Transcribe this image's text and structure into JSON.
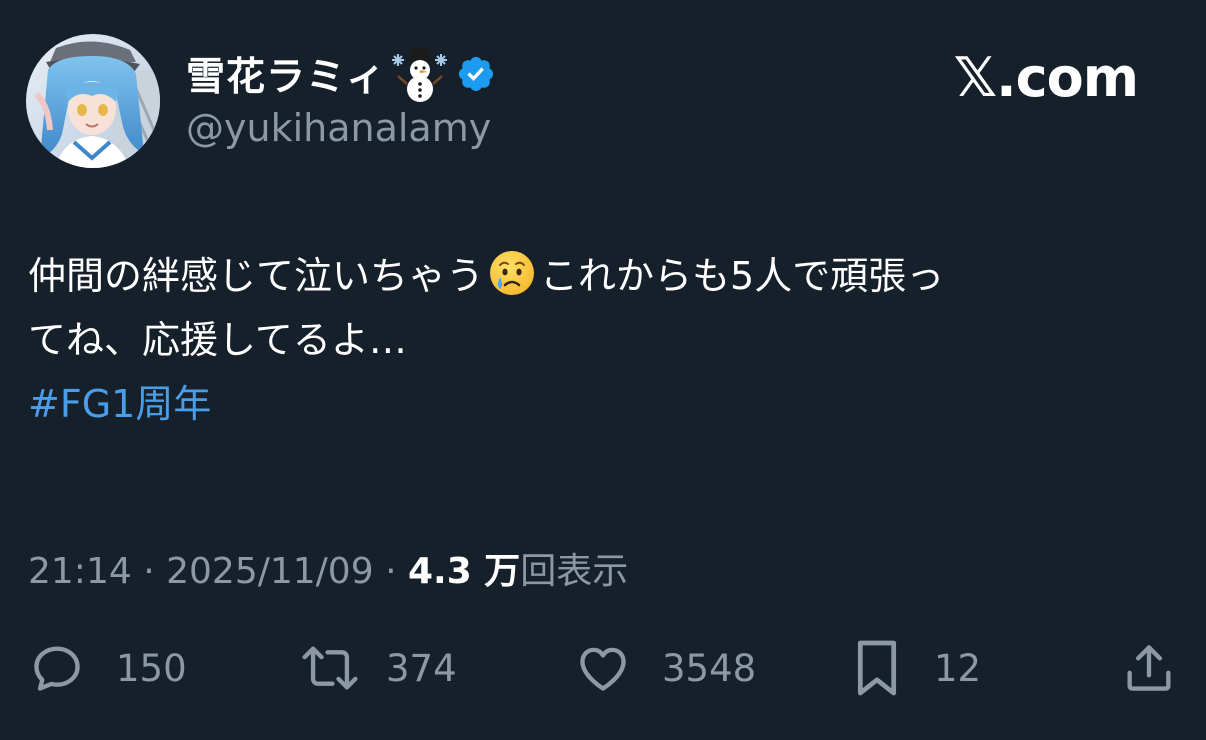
{
  "author": {
    "display_name": "雪花ラミィ",
    "handle": "@yukihanalamy",
    "verified": true,
    "name_emoji": "snowman-icon"
  },
  "brand": {
    "label": "𝕏.com"
  },
  "tweet": {
    "line1_before_emoji": "仲間の絆感じて泣いちゃう",
    "emoji": "crying-face-icon",
    "line1_after_emoji": "これからも5人で頑張っ",
    "line2": "てね、応援してるよ…",
    "hashtag": "#FG1周年"
  },
  "meta": {
    "time": "21:14",
    "separator": "·",
    "date": "2025/11/09",
    "views_count": "4.3 万",
    "views_label": "回表示"
  },
  "actions": {
    "replies": "150",
    "retweets": "374",
    "likes": "3548",
    "bookmarks": "12"
  },
  "colors": {
    "background": "#15202b",
    "text": "#ffffff",
    "secondary": "#8b98a5",
    "link": "#4a9de8",
    "verified": "#1d9bf0"
  }
}
